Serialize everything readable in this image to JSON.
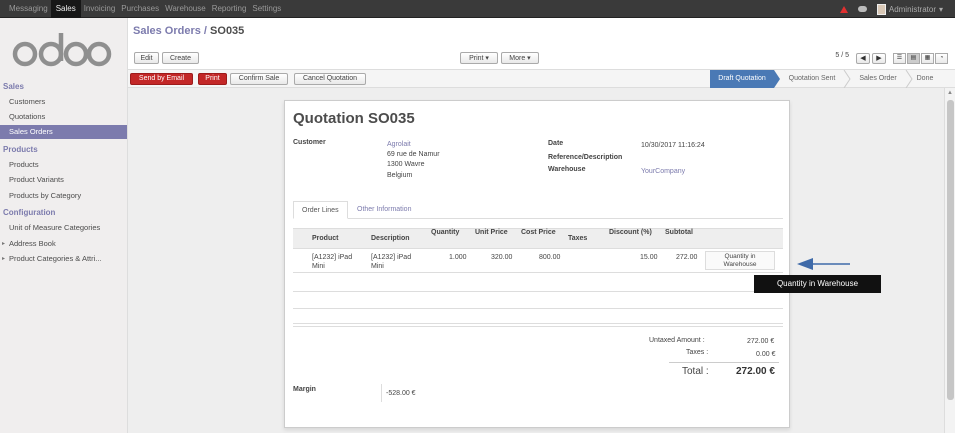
{
  "topbar": {
    "menu": [
      "Messaging",
      "Sales",
      "Invoicing",
      "Purchases",
      "Warehouse",
      "Reporting",
      "Settings"
    ],
    "active": "Sales",
    "user": "Administrator"
  },
  "sidebar": {
    "logo": "odoo",
    "sections": [
      {
        "title": "Sales",
        "items": [
          "Customers",
          "Quotations",
          "Sales Orders"
        ]
      },
      {
        "title": "Products",
        "items": [
          "Products",
          "Product Variants",
          "Products by Category"
        ]
      },
      {
        "title": "Configuration",
        "items": [
          "Unit of Measure Categories",
          "Address Book",
          "Product Categories & Attri..."
        ]
      }
    ],
    "active_item": "Sales Orders"
  },
  "header": {
    "breadcrumb_parent": "Sales Orders",
    "breadcrumb_sep": " / ",
    "breadcrumb_current": "SO035",
    "edit_label": "Edit",
    "create_label": "Create",
    "print_label": "Print ▾",
    "more_label": "More ▾",
    "pager": "5 / 5"
  },
  "actions": {
    "send_email": "Send by Email",
    "print": "Print",
    "confirm": "Confirm Sale",
    "cancel": "Cancel Quotation"
  },
  "stages": [
    "Draft Quotation",
    "Quotation Sent",
    "Sales Order",
    "Done"
  ],
  "active_stage": "Draft Quotation",
  "form": {
    "title": "Quotation SO035",
    "customer_label": "Customer",
    "customer_name": "Agrolait",
    "customer_addr1": "69 rue de Namur",
    "customer_addr2": "1300 Wavre",
    "customer_addr3": "Belgium",
    "date_label": "Date",
    "date_value": "10/30/2017 11:16:24",
    "ref_label": "Reference/Description",
    "warehouse_label": "Warehouse",
    "warehouse_value": "YourCompany",
    "tab_order_lines": "Order Lines",
    "tab_other": "Other Information",
    "columns": {
      "product": "Product",
      "description": "Description",
      "quantity": "Quantity",
      "unit_price": "Unit Price",
      "cost_price": "Cost Price",
      "taxes": "Taxes",
      "discount": "Discount (%)",
      "subtotal": "Subtotal"
    },
    "line": {
      "product_1": "[A1232] iPad",
      "product_2": "Mini",
      "desc_1": "[A1232] iPad",
      "desc_2": "Mini",
      "quantity": "1.000",
      "unit_price": "320.00",
      "cost_price": "800.00",
      "discount": "15.00",
      "subtotal": "272.00",
      "qty_wh_1": "Quantity in",
      "qty_wh_2": "Warehouse"
    },
    "untaxed_label": "Untaxed Amount :",
    "untaxed_value": "272.00 €",
    "taxes_label": "Taxes :",
    "taxes_value": "0.00 €",
    "total_label": "Total :",
    "total_value": "272.00 €",
    "margin_label": "Margin",
    "margin_value": "-528.00 €"
  },
  "tooltip": "Quantity in Warehouse",
  "colors": {
    "brand": "#7c7bad",
    "danger": "#c32727",
    "stage_active": "#4a79b5"
  }
}
